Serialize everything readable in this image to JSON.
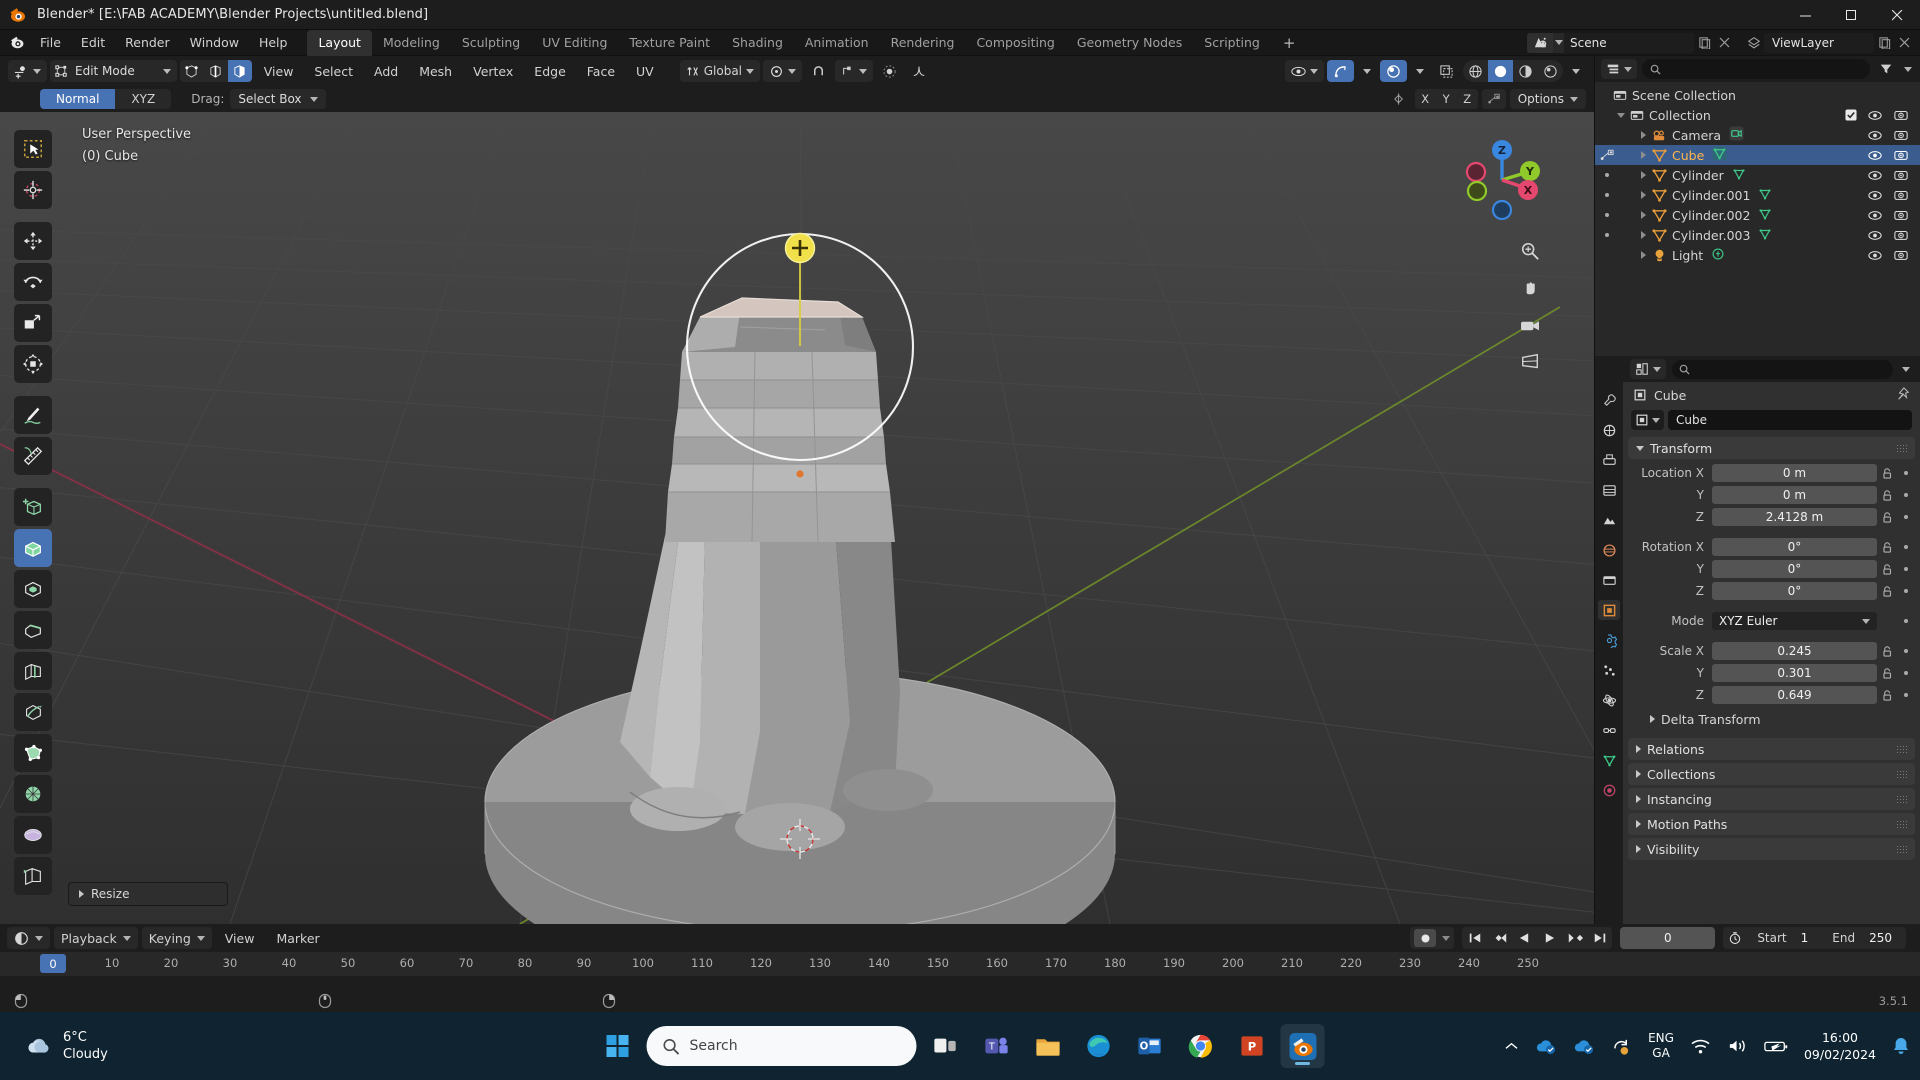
{
  "window": {
    "title": "Blender* [E:\\FAB ACADEMY\\Blender Projects\\untitled.blend]",
    "minimize": "–",
    "maximize": "❐",
    "close": "✕"
  },
  "topbar": {
    "menus": [
      "File",
      "Edit",
      "Render",
      "Window",
      "Help"
    ],
    "workspaces": [
      {
        "label": "Layout",
        "active": true
      },
      {
        "label": "Modeling",
        "active": false
      },
      {
        "label": "Sculpting",
        "active": false
      },
      {
        "label": "UV Editing",
        "active": false
      },
      {
        "label": "Texture Paint",
        "active": false
      },
      {
        "label": "Shading",
        "active": false
      },
      {
        "label": "Animation",
        "active": false
      },
      {
        "label": "Rendering",
        "active": false
      },
      {
        "label": "Compositing",
        "active": false
      },
      {
        "label": "Geometry Nodes",
        "active": false
      },
      {
        "label": "Scripting",
        "active": false
      }
    ],
    "add_workspace": "+",
    "scene_name": "Scene",
    "view_layer_name": "ViewLayer"
  },
  "viewport_header": {
    "mode": "Edit Mode",
    "menus": [
      "View",
      "Select",
      "Add",
      "Mesh",
      "Vertex",
      "Edge",
      "Face",
      "UV"
    ],
    "orientation": "Global",
    "mesh_select_modes": [
      "vertex",
      "edge",
      "face"
    ],
    "active_select_mode": "face"
  },
  "tool_settings": {
    "transform_tabs": [
      {
        "label": "Normal",
        "active": true
      },
      {
        "label": "XYZ",
        "active": false
      }
    ],
    "drag_label": "Drag:",
    "drag_value": "Select Box",
    "axis_buttons": [
      "X",
      "Y",
      "Z"
    ],
    "options_label": "Options"
  },
  "viewport": {
    "perspective_label": "User Perspective",
    "object_label": "(0) Cube",
    "operator_panel": "Resize",
    "gizmo_axes": [
      "Z",
      "Y",
      "X"
    ],
    "colors": {
      "axis_x": "#e5486e",
      "axis_y": "#8fc92a",
      "axis_z": "#3a87e0",
      "accent_blue": "#4772b3",
      "selected_orange": "#ffb64a",
      "cursor_yellow": "#f2e04b"
    },
    "tools": [
      "tweak-tool",
      "cursor-tool",
      "move-tool",
      "rotate-tool",
      "scale-tool",
      "transform-tool",
      "annotate-tool",
      "measure-tool",
      "add-cube-tool",
      "extrude-region-tool",
      "inset-faces-tool",
      "bevel-tool",
      "loop-cut-tool",
      "knife-tool",
      "poly-build-tool",
      "spin-tool",
      "smooth-tool",
      "edge-slide-tool"
    ],
    "active_tool_index": 8
  },
  "outliner": {
    "display_mode": "View Layer",
    "search_placeholder": "",
    "filter_icon": "funnel-icon",
    "rows": [
      {
        "name": "Scene Collection",
        "indent": 0,
        "icon": "scene-collection-icon",
        "expand": "none",
        "selected": false,
        "checkbox": false,
        "eye": false,
        "camera": false
      },
      {
        "name": "Collection",
        "indent": 1,
        "icon": "collection-icon",
        "expand": "down",
        "selected": false,
        "checkbox": true,
        "eye": true,
        "camera": true
      },
      {
        "name": "Camera",
        "indent": 2,
        "icon": "camera-data-icon",
        "expand": "right",
        "selected": false,
        "checkbox": false,
        "eye": true,
        "camera": true
      },
      {
        "name": "Cube",
        "indent": 2,
        "icon": "mesh-icon",
        "expand": "right",
        "selected": true,
        "checkbox": false,
        "eye": true,
        "camera": true
      },
      {
        "name": "Cylinder",
        "indent": 2,
        "icon": "mesh-icon",
        "expand": "right",
        "selected": false,
        "checkbox": false,
        "eye": true,
        "camera": true
      },
      {
        "name": "Cylinder.001",
        "indent": 2,
        "icon": "mesh-icon",
        "expand": "right",
        "selected": false,
        "checkbox": false,
        "eye": true,
        "camera": true
      },
      {
        "name": "Cylinder.002",
        "indent": 2,
        "icon": "mesh-icon",
        "expand": "right",
        "selected": false,
        "checkbox": false,
        "eye": true,
        "camera": true
      },
      {
        "name": "Cylinder.003",
        "indent": 2,
        "icon": "mesh-icon",
        "expand": "right",
        "selected": false,
        "checkbox": false,
        "eye": true,
        "camera": true
      },
      {
        "name": "Light",
        "indent": 2,
        "icon": "light-icon",
        "expand": "right",
        "selected": false,
        "checkbox": false,
        "eye": true,
        "camera": true
      }
    ]
  },
  "properties": {
    "breadcrumb_object": "Cube",
    "id_name": "Cube",
    "tabs": [
      "tool-tab",
      "render-tab",
      "output-tab",
      "view-layer-tab",
      "scene-tab",
      "world-tab",
      "collection-tab",
      "object-tab",
      "modifier-tab",
      "particle-tab",
      "physics-tab",
      "constraint-tab",
      "data-tab",
      "material-tab"
    ],
    "active_tab": "object-tab",
    "transform": {
      "title": "Transform",
      "location": {
        "label": "Location X",
        "x": "0 m",
        "y": "0 m",
        "z": "2.4128 m"
      },
      "rotation": {
        "label": "Rotation X",
        "x": "0°",
        "y": "0°",
        "z": "0°"
      },
      "mode_label": "Mode",
      "mode_value": "XYZ Euler",
      "scale": {
        "label": "Scale X",
        "x": "0.245",
        "y": "0.301",
        "z": "0.649"
      },
      "axis_y": "Y",
      "axis_z": "Z",
      "delta_transform": "Delta Transform"
    },
    "collapsed_panels": [
      "Relations",
      "Collections",
      "Instancing",
      "Motion Paths",
      "Visibility"
    ]
  },
  "timeline": {
    "menus": [
      "View",
      "Marker"
    ],
    "playback": "Playback",
    "keying": "Keying",
    "current_frame": "0",
    "start_label": "Start",
    "start_value": "1",
    "end_label": "End",
    "end_value": "250",
    "ticks": [
      0,
      10,
      20,
      30,
      40,
      50,
      60,
      70,
      80,
      90,
      100,
      110,
      120,
      130,
      140,
      150,
      160,
      170,
      180,
      190,
      200,
      210,
      220,
      230,
      240,
      250
    ],
    "playhead_frame": 0,
    "version": "3.5.1"
  },
  "taskbar": {
    "weather_temp": "6°C",
    "weather_desc": "Cloudy",
    "search_placeholder": "Search",
    "apps": [
      {
        "name": "start-button",
        "active": false
      },
      {
        "name": "search-box",
        "active": false
      },
      {
        "name": "task-view-button",
        "active": false
      },
      {
        "name": "teams-app",
        "active": false
      },
      {
        "name": "file-explorer-app",
        "active": false
      },
      {
        "name": "edge-browser-app",
        "active": false
      },
      {
        "name": "outlook-app",
        "active": false
      },
      {
        "name": "chrome-browser-app",
        "active": false
      },
      {
        "name": "powerpoint-app",
        "active": false
      },
      {
        "name": "blender-app",
        "active": true
      }
    ],
    "language": "ENG",
    "region": "GA",
    "time": "16:00",
    "date": "09/02/2024"
  }
}
